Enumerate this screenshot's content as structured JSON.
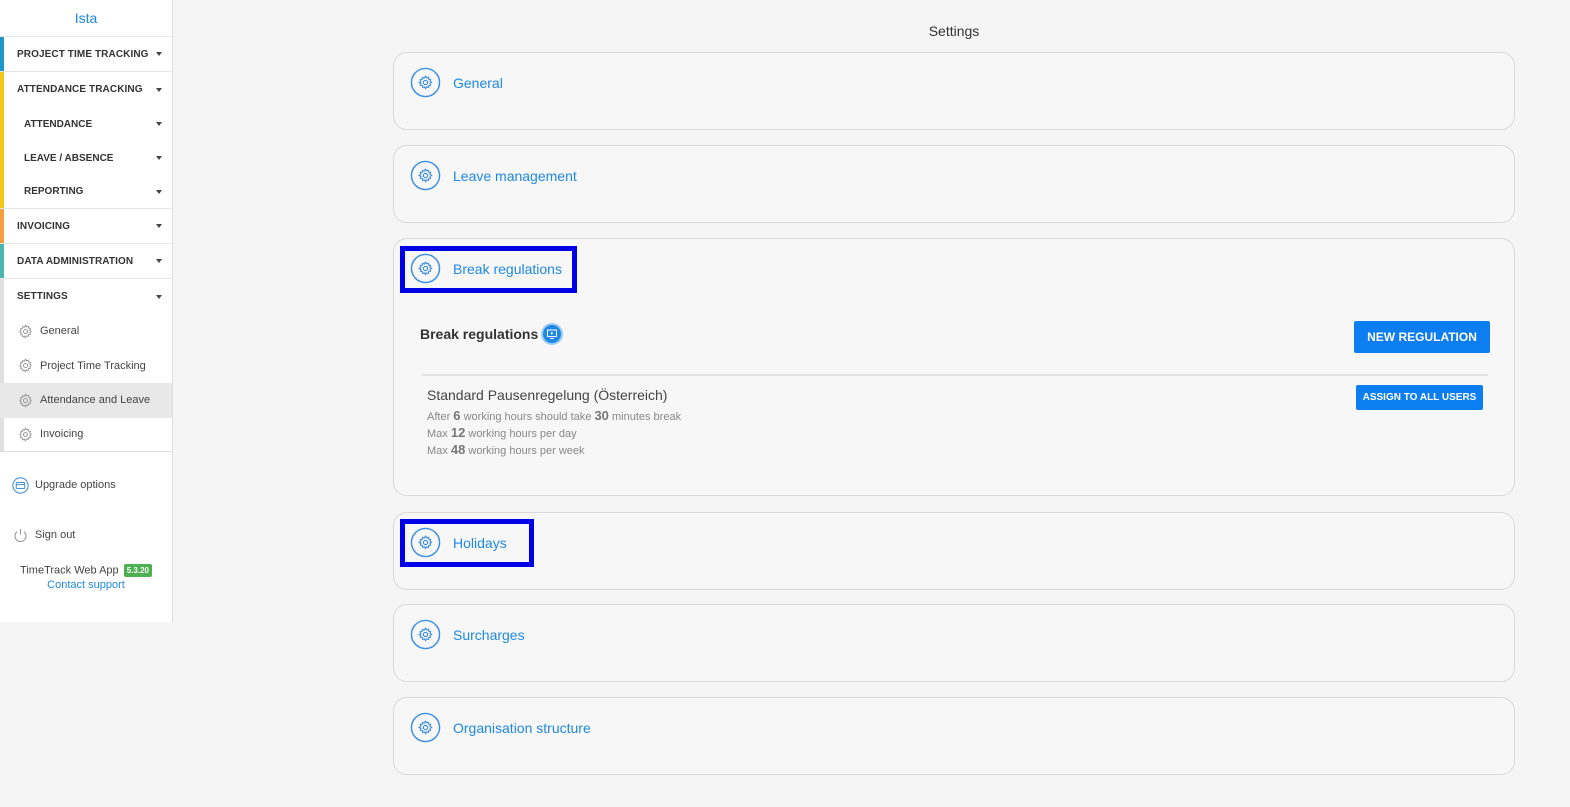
{
  "app": {
    "brand": "Ista"
  },
  "sidebar": {
    "sections": [
      {
        "label": "PROJECT TIME TRACKING",
        "color": "#2196c9"
      },
      {
        "label": "ATTENDANCE TRACKING",
        "color": "#f5c518"
      },
      {
        "label": "INVOICING",
        "color": "#f2a03d"
      },
      {
        "label": "DATA ADMINISTRATION",
        "color": "#4db6ac"
      },
      {
        "label": "SETTINGS",
        "color": "#e0e0e0"
      }
    ],
    "attendance_sub": [
      "ATTENDANCE",
      "LEAVE / ABSENCE",
      "REPORTING"
    ],
    "settings_items": [
      "General",
      "Project Time Tracking",
      "Attendance and Leave",
      "Invoicing"
    ],
    "active_settings_item": "Attendance and Leave",
    "upgrade": "Upgrade options",
    "signout": "Sign out",
    "footer": {
      "app_name": "TimeTrack Web App",
      "version": "5.3.20",
      "support": "Contact support"
    }
  },
  "main": {
    "title": "Settings",
    "cards": [
      {
        "title": "General"
      },
      {
        "title": "Leave management"
      },
      {
        "title": "Break regulations"
      },
      {
        "title": "Holidays"
      },
      {
        "title": "Surcharges"
      },
      {
        "title": "Organisation structure"
      }
    ],
    "break_regulations": {
      "heading": "Break regulations",
      "new_button": "NEW REGULATION",
      "assign_button": "ASSIGN TO ALL USERS",
      "rule": {
        "name": "Standard Pausenregelung (Österreich)",
        "line1": {
          "pre": "After",
          "hours": "6",
          "mid": "working hours should take",
          "minutes": "30",
          "post": "minutes break"
        },
        "line2": {
          "pre": "Max",
          "value": "12",
          "post": "working hours per day"
        },
        "line3": {
          "pre": "Max",
          "value": "48",
          "post": "working hours per week"
        }
      }
    }
  },
  "colors": {
    "accent": "#1e88e5",
    "button": "#0d7ef2",
    "highlight": "#0000e6",
    "version_badge": "#4caf50"
  }
}
